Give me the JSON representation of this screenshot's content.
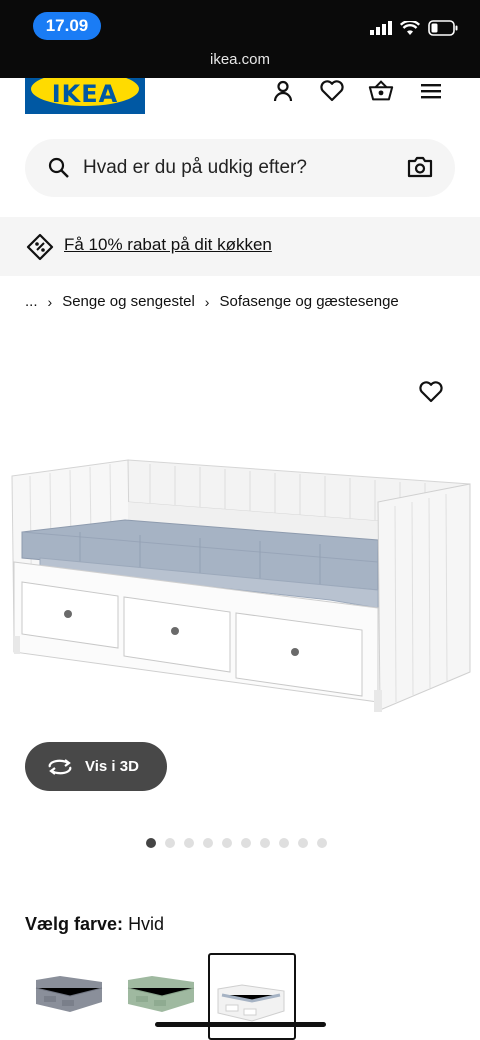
{
  "status": {
    "time": "17.09",
    "url": "ikea.com"
  },
  "brand": {
    "logo_text": "IKEA",
    "blue": "#0058a3",
    "yellow": "#ffdb00"
  },
  "header_icons": [
    "user-icon",
    "heart-icon",
    "basket-icon",
    "menu-icon"
  ],
  "search": {
    "placeholder": "Hvad er du på udkig efter?"
  },
  "promo": {
    "text": "Få 10% rabat på dit køkken"
  },
  "breadcrumb": {
    "ellipsis": "...",
    "items": [
      "Senge og sengestel",
      "Sofasenge og gæstesenge"
    ]
  },
  "gallery": {
    "view3d_label": "Vis i 3D",
    "image_count": 10,
    "active_index": 0
  },
  "colour": {
    "label": "Vælg farve:",
    "value": "Hvid",
    "options": [
      "grå",
      "grøn",
      "hvid"
    ],
    "selected": 2
  }
}
